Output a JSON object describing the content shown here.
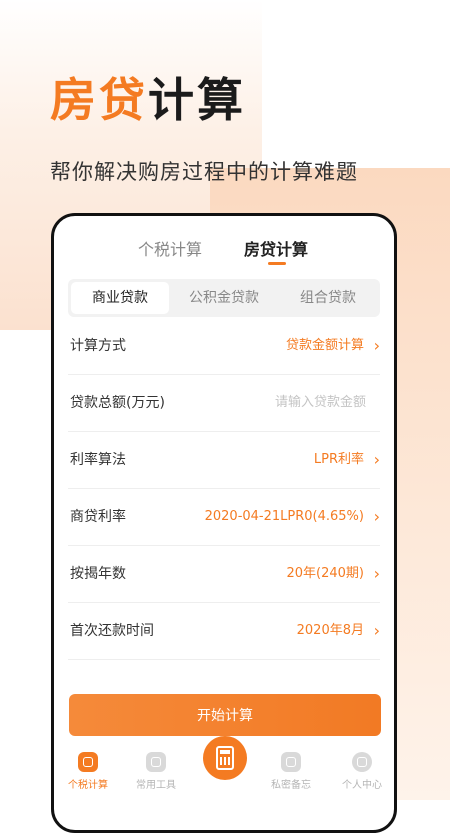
{
  "hero": {
    "title_accent": "房贷",
    "title_rest": "计算",
    "subtitle": "帮你解决购房过程中的计算难题"
  },
  "tabs": [
    {
      "label": "个税计算",
      "active": false
    },
    {
      "label": "房贷计算",
      "active": true
    }
  ],
  "segments": [
    {
      "label": "商业贷款",
      "active": true
    },
    {
      "label": "公积金贷款",
      "active": false
    },
    {
      "label": "组合贷款",
      "active": false
    }
  ],
  "form": {
    "calc_method": {
      "label": "计算方式",
      "value": "贷款金额计算"
    },
    "loan_total": {
      "label": "贷款总额(万元)",
      "placeholder": "请输入贷款金额"
    },
    "rate_method": {
      "label": "利率算法",
      "value": "LPR利率"
    },
    "commercial_rate": {
      "label": "商贷利率",
      "value": "2020-04-21LPR0(4.65%)"
    },
    "years": {
      "label": "按揭年数",
      "value": "20年(240期)"
    },
    "first_payment": {
      "label": "首次还款时间",
      "value": "2020年8月"
    }
  },
  "start_button": "开始计算",
  "bottom_nav": [
    {
      "label": "个税计算",
      "icon": "calculator-grid-icon",
      "active": true
    },
    {
      "label": "常用工具",
      "icon": "tools-grid-icon",
      "active": false
    },
    {
      "label": "",
      "icon": "calculator-icon",
      "active": false
    },
    {
      "label": "私密备忘",
      "icon": "memo-icon",
      "active": false
    },
    {
      "label": "个人中心",
      "icon": "user-icon",
      "active": false
    }
  ],
  "colors": {
    "accent": "#f47b22",
    "text": "#222222",
    "muted": "#888888"
  }
}
